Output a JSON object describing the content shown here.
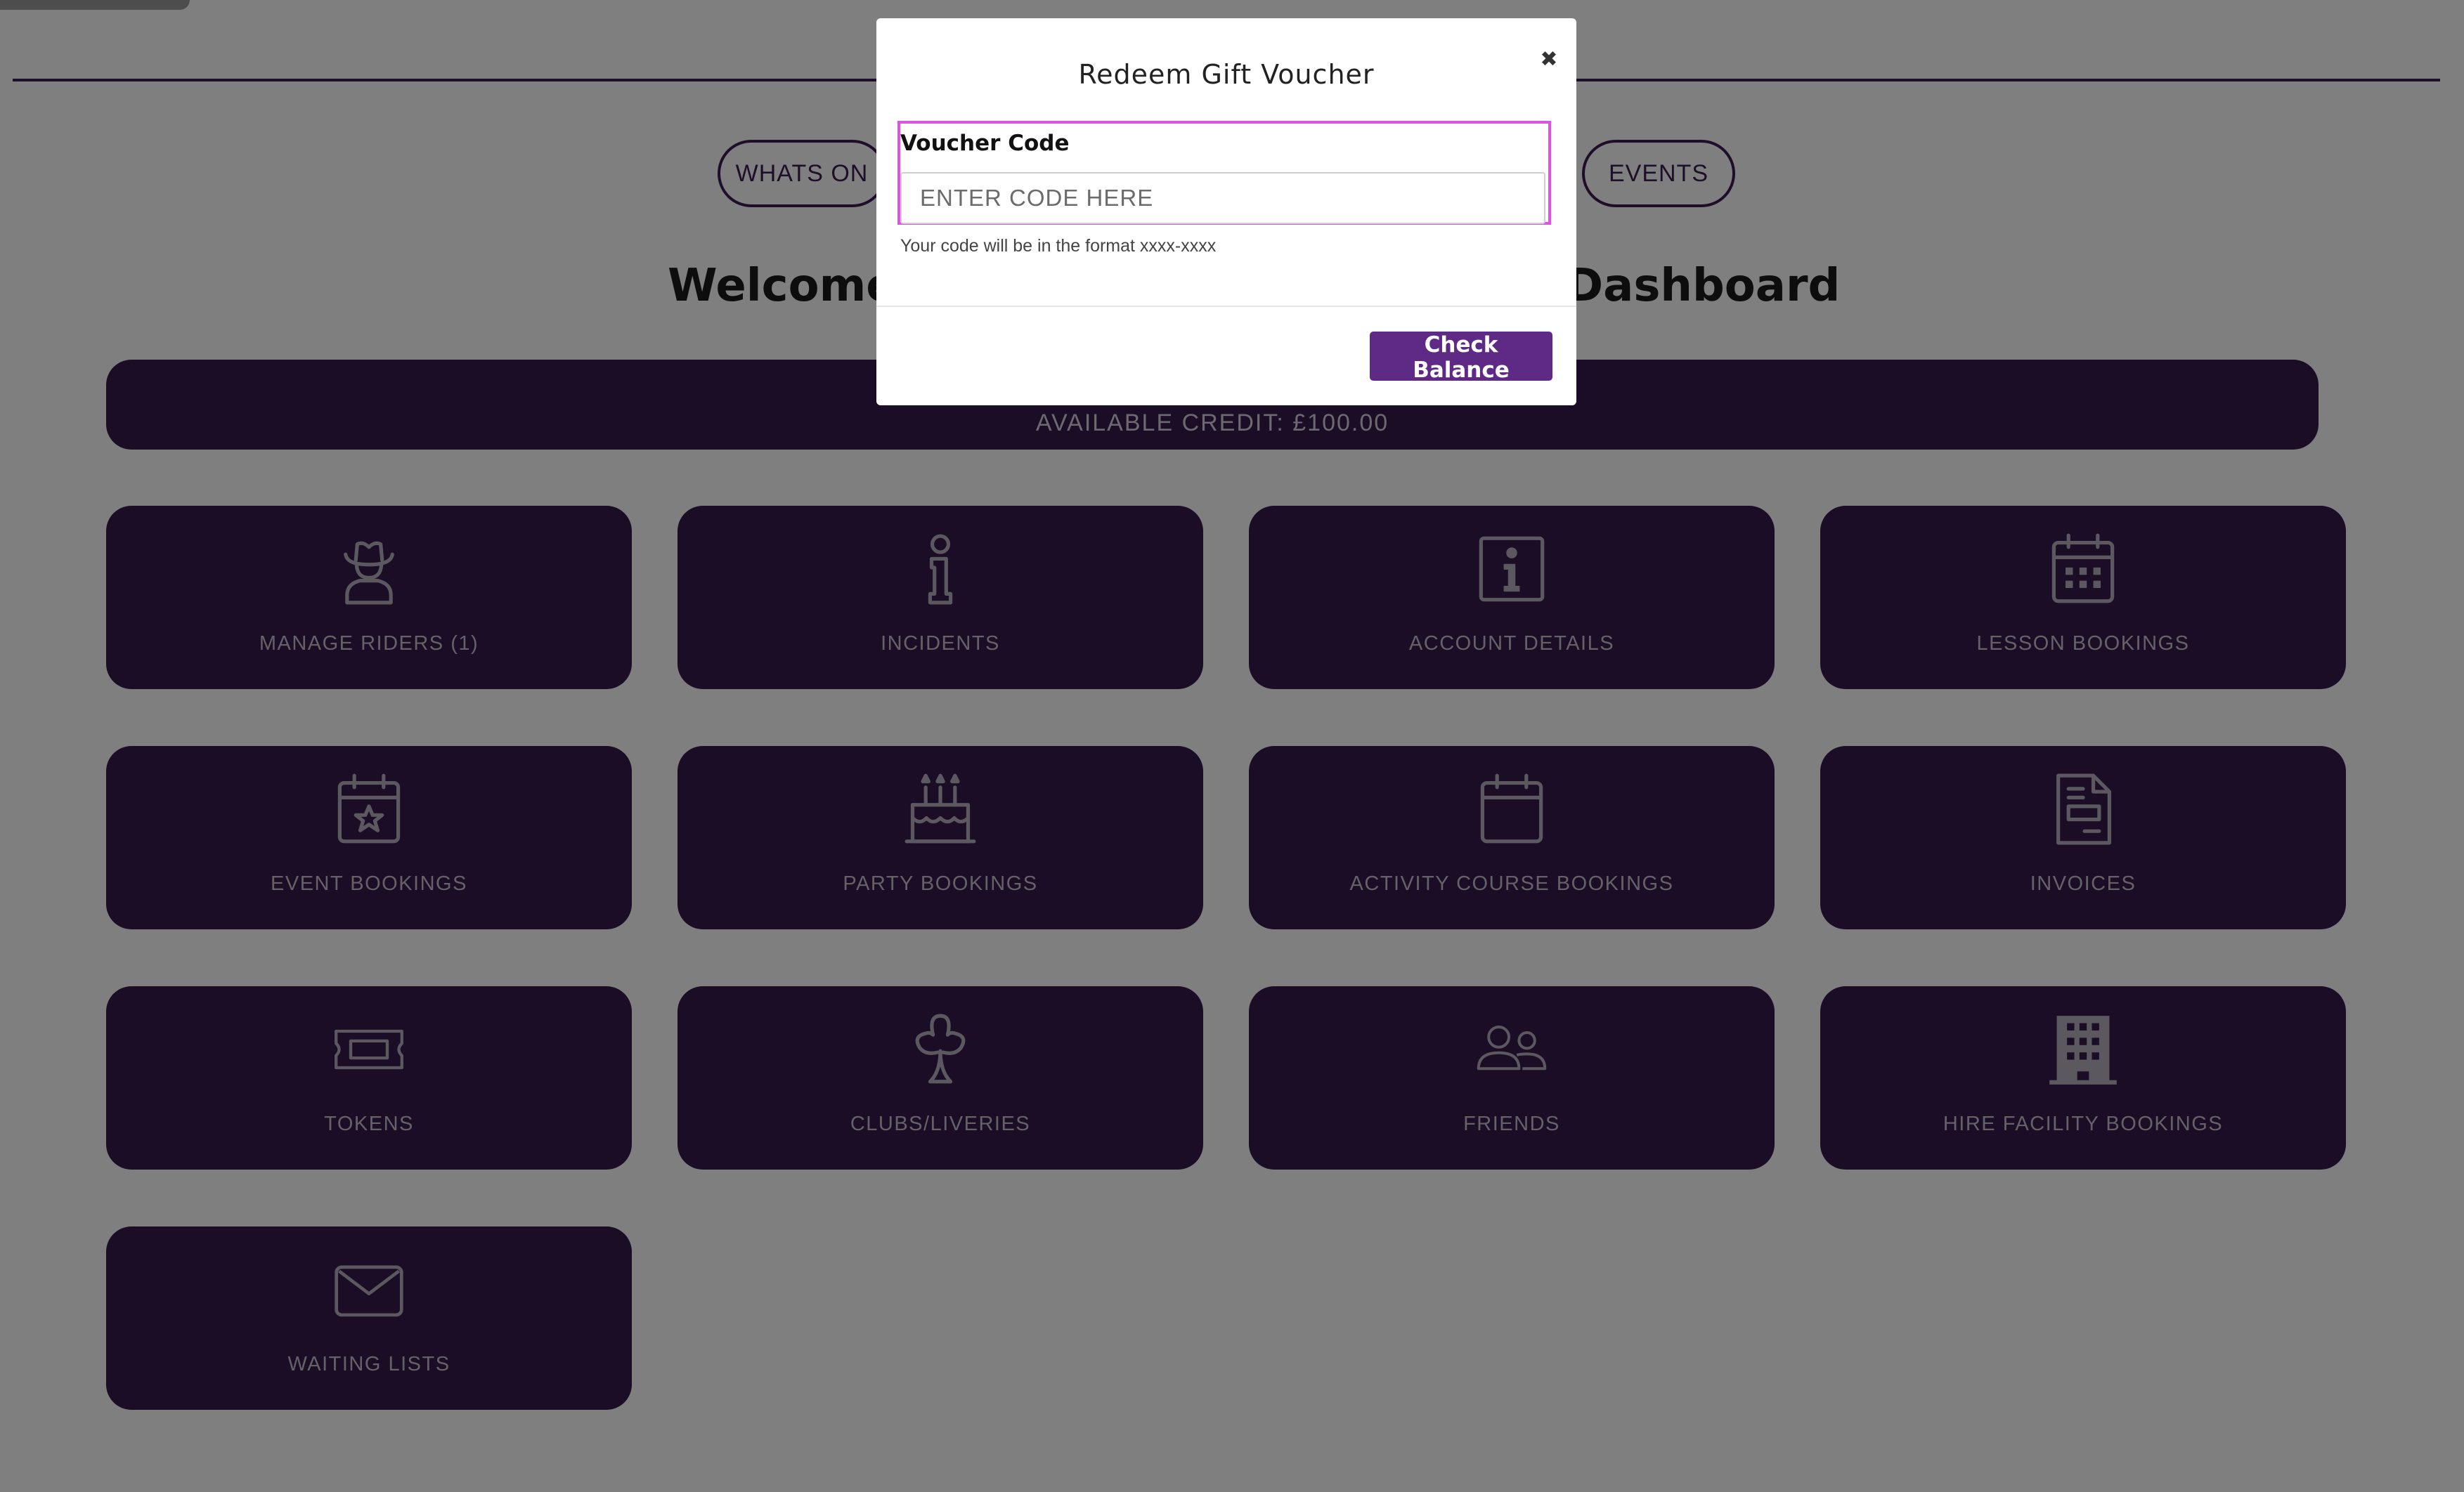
{
  "nav": {
    "pills": [
      "WHATS ON",
      "EVENTS"
    ]
  },
  "welcome": {
    "left": "Welcome t",
    "right": "Dashboard"
  },
  "credit": {
    "label": "AVAILABLE CREDIT: £100.00"
  },
  "tiles": [
    {
      "label": "MANAGE RIDERS (1)",
      "icon": "cowboy-rider-icon"
    },
    {
      "label": "INCIDENTS",
      "icon": "info-i-icon"
    },
    {
      "label": "ACCOUNT DETAILS",
      "icon": "info-box-icon"
    },
    {
      "label": "LESSON BOOKINGS",
      "icon": "calendar-grid-icon"
    },
    {
      "label": "EVENT BOOKINGS",
      "icon": "calendar-star-icon"
    },
    {
      "label": "PARTY BOOKINGS",
      "icon": "birthday-cake-icon"
    },
    {
      "label": "ACTIVITY COURSE BOOKINGS",
      "icon": "calendar-icon"
    },
    {
      "label": "INVOICES",
      "icon": "invoice-document-icon"
    },
    {
      "label": "TOKENS",
      "icon": "ticket-icon"
    },
    {
      "label": "CLUBS/LIVERIES",
      "icon": "club-icon"
    },
    {
      "label": "FRIENDS",
      "icon": "users-icon"
    },
    {
      "label": "HIRE FACILITY BOOKINGS",
      "icon": "building-icon"
    },
    {
      "label": "WAITING LISTS",
      "icon": "envelope-icon"
    }
  ],
  "modal": {
    "title": "Redeem Gift Voucher",
    "close_glyph": "✖",
    "voucher_label": "Voucher Code",
    "voucher_placeholder": "ENTER CODE HERE",
    "voucher_value": "",
    "hint": "Your code will be in the format xxxx-xxxx",
    "button_label": "Check Balance"
  },
  "colors": {
    "brand_purple": "#361b4b",
    "button_purple": "#5f2a86",
    "highlight": "#e052e6"
  }
}
